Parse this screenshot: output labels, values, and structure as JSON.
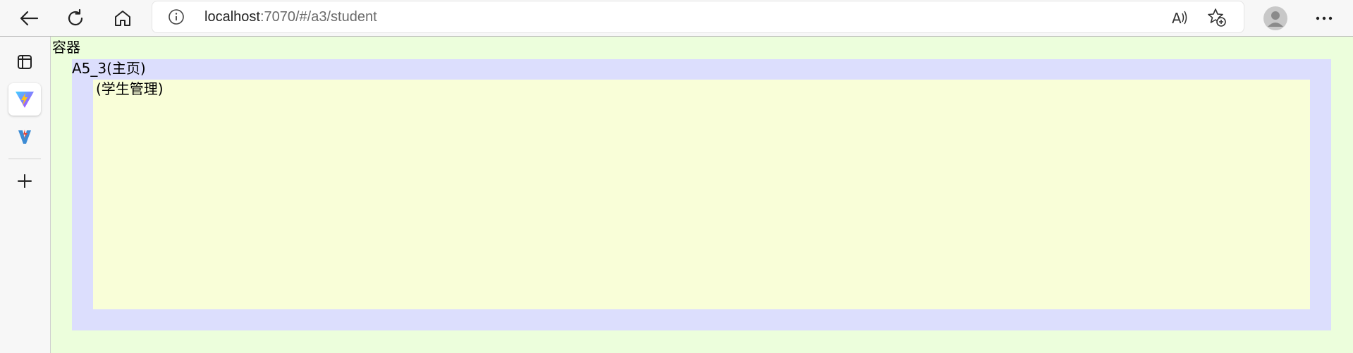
{
  "browser": {
    "url_host": "localhost",
    "url_rest": ":7070/#/a3/student",
    "icons": {
      "back": "back-arrow-icon",
      "refresh": "refresh-icon",
      "home": "home-icon",
      "info": "info-icon",
      "read_aloud": "read-aloud-icon",
      "favorite": "add-favorite-icon",
      "profile": "profile-avatar-icon",
      "more": "more-options-icon"
    }
  },
  "sidebar": {
    "items": [
      {
        "icon": "tab-actions-icon"
      },
      {
        "icon": "vite-app-icon"
      },
      {
        "icon": "vitest-app-icon"
      },
      {
        "icon": "add-icon"
      }
    ]
  },
  "page": {
    "container_label": "容器",
    "a5_label": "A5_3(主页)",
    "student_label": "(学生管理)"
  },
  "colors": {
    "container_bg": "#ecfedc",
    "a5_bg": "#dcdefd",
    "student_bg": "#f9fed8"
  }
}
